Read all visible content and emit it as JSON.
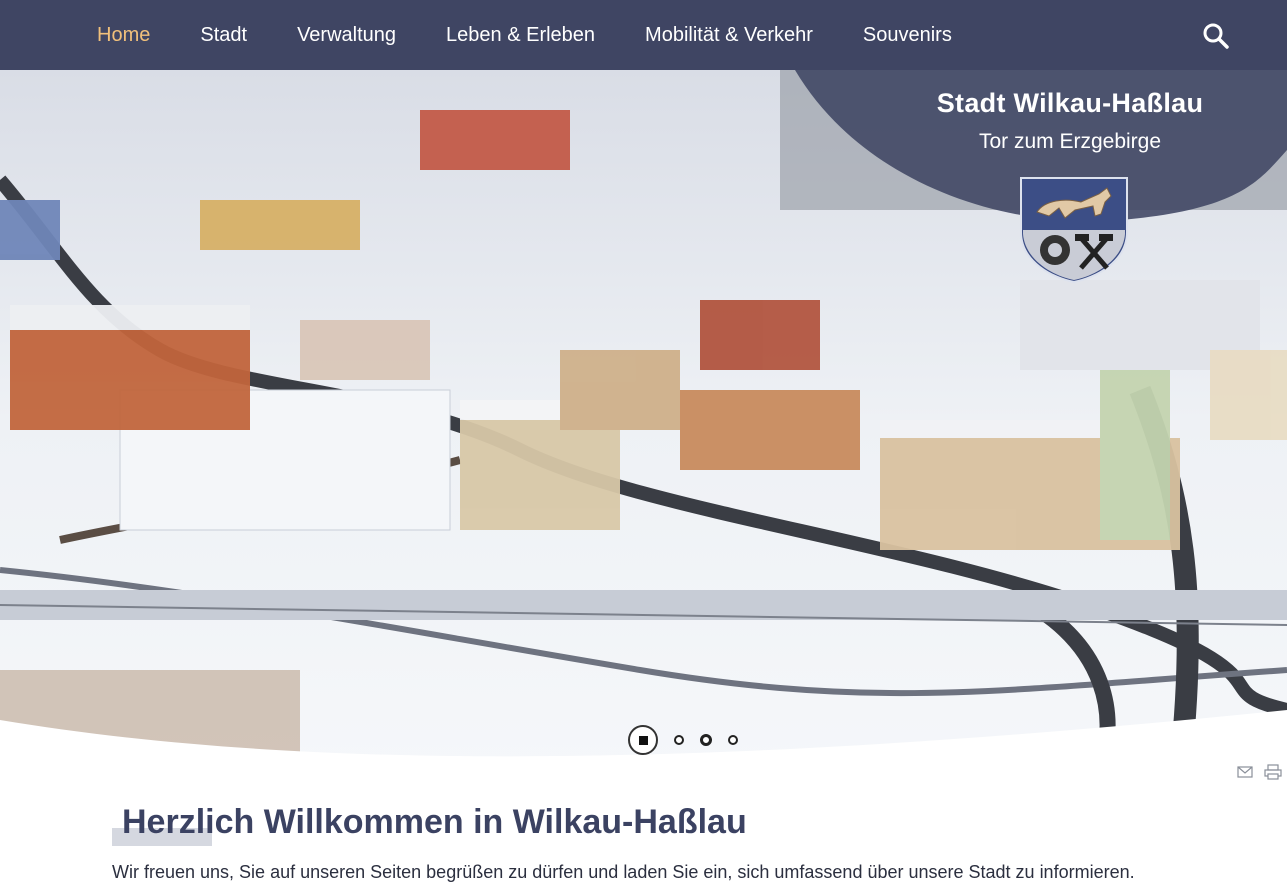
{
  "nav": {
    "items": [
      {
        "label": "Home",
        "active": true
      },
      {
        "label": "Stadt",
        "active": false
      },
      {
        "label": "Verwaltung",
        "active": false
      },
      {
        "label": "Leben & Erleben",
        "active": false
      },
      {
        "label": "Mobilität & Verkehr",
        "active": false
      },
      {
        "label": "Souvenirs",
        "active": false
      }
    ],
    "search_icon": "search-icon",
    "active_color": "#f1c07b",
    "bg_color": "#3f4563"
  },
  "hero": {
    "title": "Stadt Wilkau-Haßlau",
    "subtitle": "Tor zum Erzgebirge",
    "crest_icon": "coat-of-arms-icon",
    "slides_total": 4,
    "slide_active": 1
  },
  "tools": {
    "email_icon": "email-icon",
    "print_icon": "print-icon"
  },
  "content": {
    "title": "Herzlich Willkommen in Wilkau-Haßlau",
    "intro": "Wir freuen uns, Sie auf unseren Seiten begrüßen zu dürfen und laden Sie ein, sich umfassend über unsere Stadt zu informieren."
  }
}
